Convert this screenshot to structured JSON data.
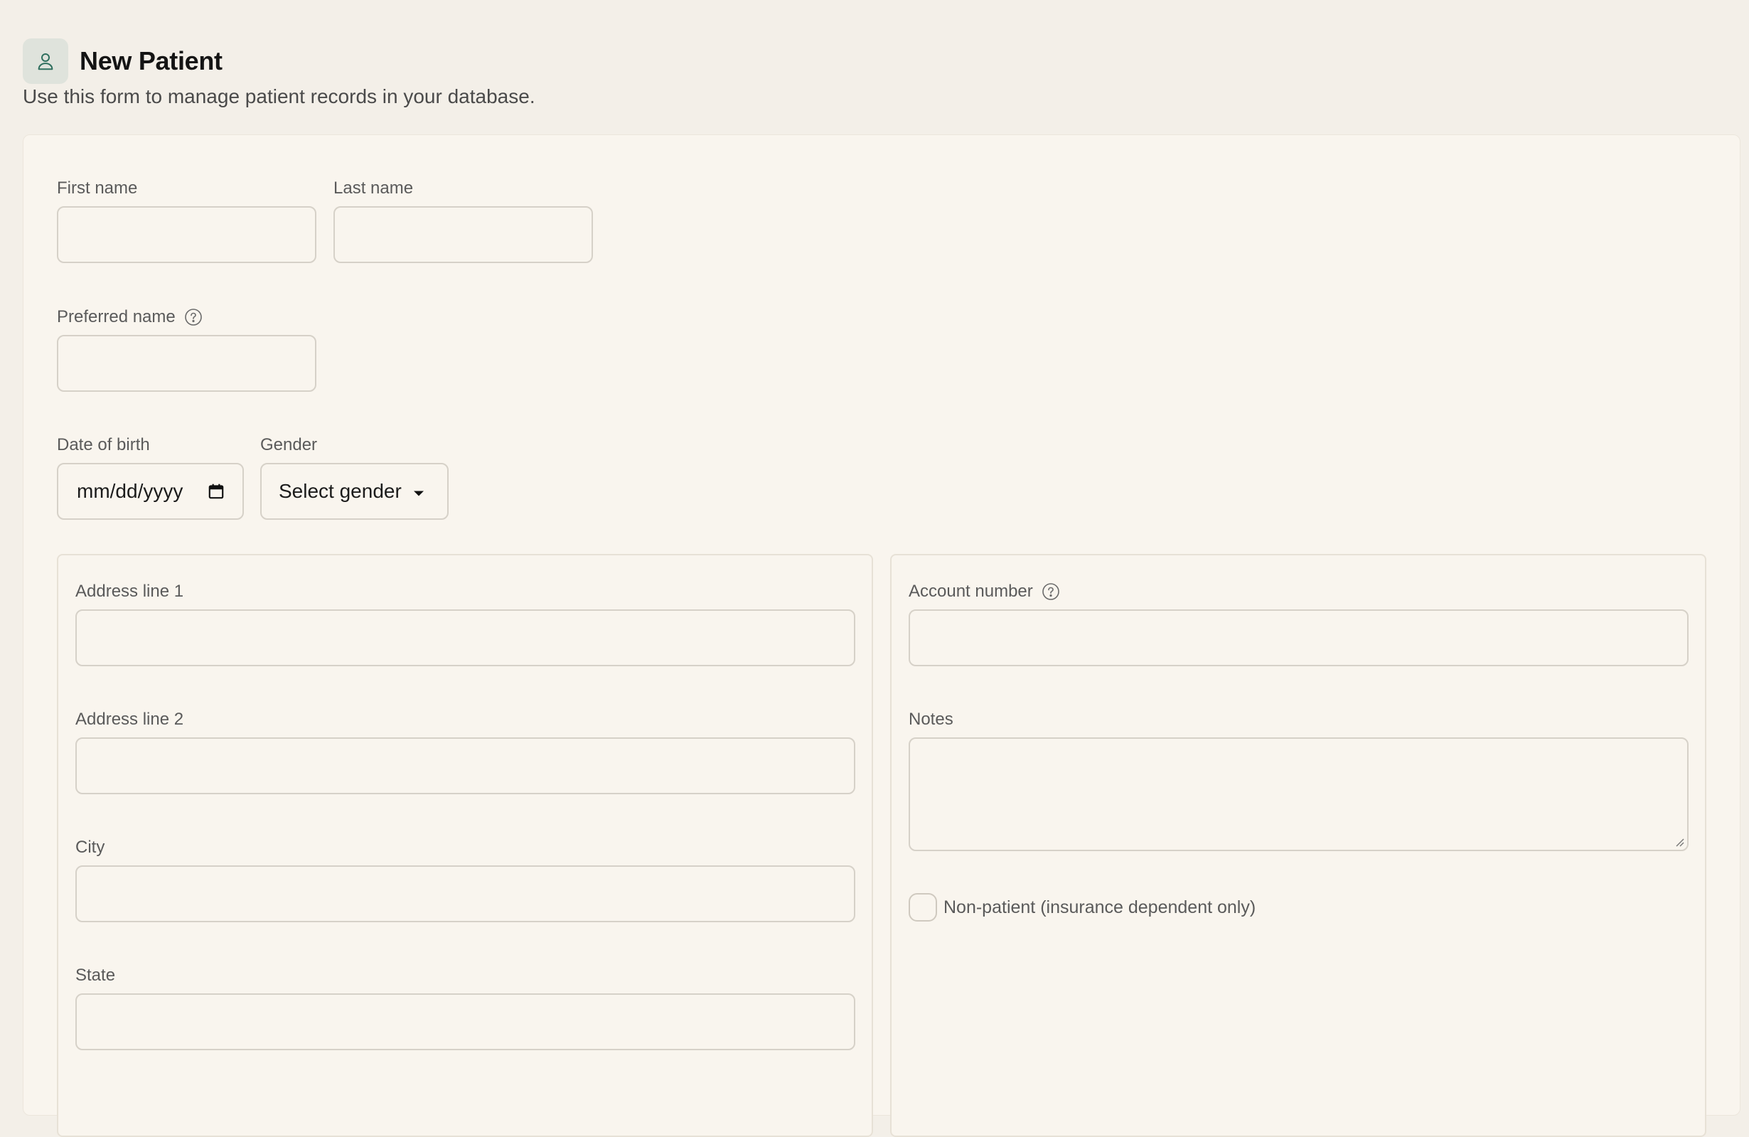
{
  "header": {
    "title": "New Patient",
    "subtitle": "Use this form to manage patient records in your database.",
    "icon": "user-icon"
  },
  "form": {
    "first_name": {
      "label": "First name",
      "value": "",
      "placeholder": ""
    },
    "last_name": {
      "label": "Last name",
      "value": "",
      "placeholder": ""
    },
    "preferred_name": {
      "label": "Preferred name",
      "value": "",
      "placeholder": ""
    },
    "date_of_birth": {
      "label": "Date of birth",
      "placeholder": "mm/dd/yyyy"
    },
    "gender": {
      "label": "Gender",
      "selected": "Select gender"
    },
    "address_line_1": {
      "label": "Address line 1",
      "value": ""
    },
    "address_line_2": {
      "label": "Address line 2",
      "value": ""
    },
    "city": {
      "label": "City",
      "value": ""
    },
    "state": {
      "label": "State",
      "value": ""
    },
    "account_number": {
      "label": "Account number",
      "value": ""
    },
    "notes": {
      "label": "Notes",
      "value": ""
    },
    "non_patient": {
      "label": "Non-patient (insurance dependent only)",
      "checked": false
    }
  },
  "colors": {
    "background": "#f3efe8",
    "card": "#f9f5ee",
    "border": "#d6d1c8",
    "accent": "#2f6f5e",
    "icon_bg": "#dfe3dc"
  }
}
